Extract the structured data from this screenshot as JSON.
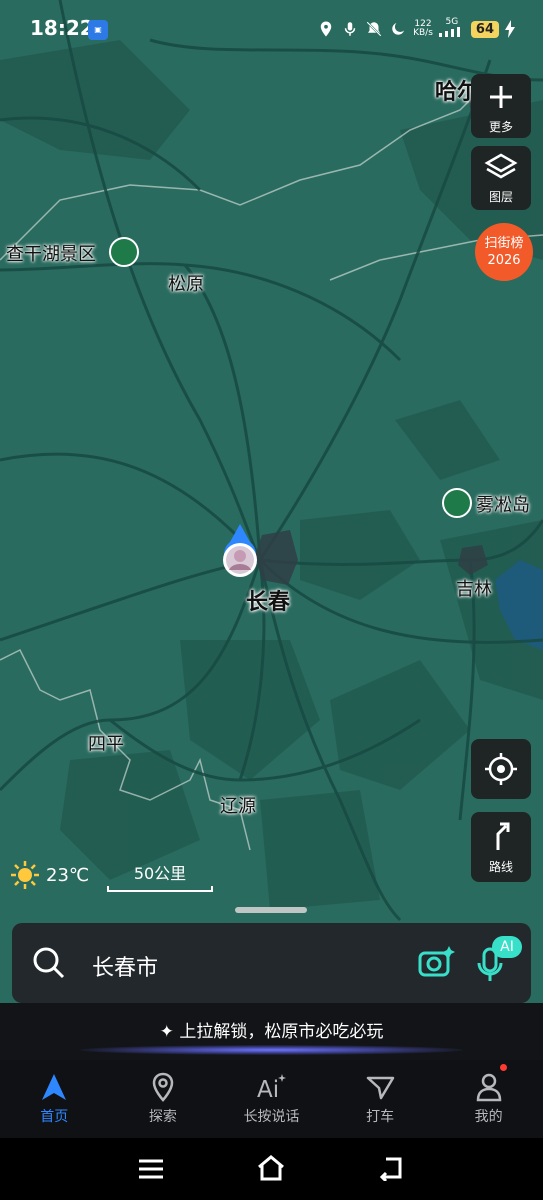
{
  "status_bar": {
    "time": "18:22",
    "net_speed_value": "122",
    "net_speed_unit": "KB/s",
    "net_type": "5G",
    "battery": "64"
  },
  "map": {
    "labels": {
      "harbin": "哈尔",
      "chagan_lake": "查干湖景区",
      "songyuan": "松原",
      "changchun": "长春",
      "wusong_island": "雾凇岛",
      "jilin": "吉林",
      "siping": "四平",
      "liaoyuan": "辽源"
    },
    "weather_temp": "23℃",
    "scale_label": "50公里"
  },
  "right_controls": {
    "more_label": "更多",
    "layers_label": "图层",
    "rank_line1": "扫街榜",
    "rank_line2": "2026",
    "route_label": "路线"
  },
  "search": {
    "value": "长春市",
    "ai_badge": "AI"
  },
  "promo": {
    "text": "上拉解锁，松原市必吃必玩"
  },
  "tabbar": {
    "home": "首页",
    "explore": "探索",
    "voice": "长按说话",
    "taxi": "打车",
    "mine": "我的"
  },
  "colors": {
    "map_bg": "#2a6b5f",
    "accent": "#2f87ff",
    "rank_badge": "#f25a2a"
  }
}
